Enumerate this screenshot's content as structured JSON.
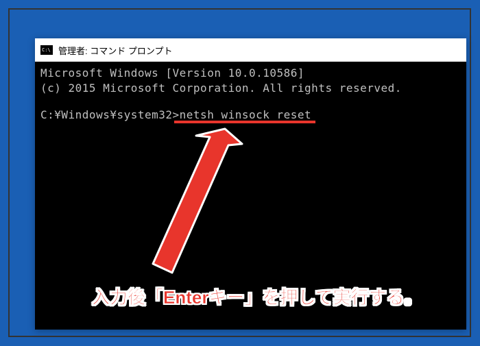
{
  "window": {
    "icon_text": "C:\\",
    "title": "管理者: コマンド プロンプト"
  },
  "terminal": {
    "line1": "Microsoft Windows [Version 10.0.10586]",
    "line2": "(c) 2015 Microsoft Corporation. All rights reserved.",
    "prompt": "C:¥Windows¥system32>",
    "command": "netsh winsock reset"
  },
  "annotation": {
    "text": "入力後「Enterキー」を押して実行する。",
    "color": "#e8352c"
  }
}
